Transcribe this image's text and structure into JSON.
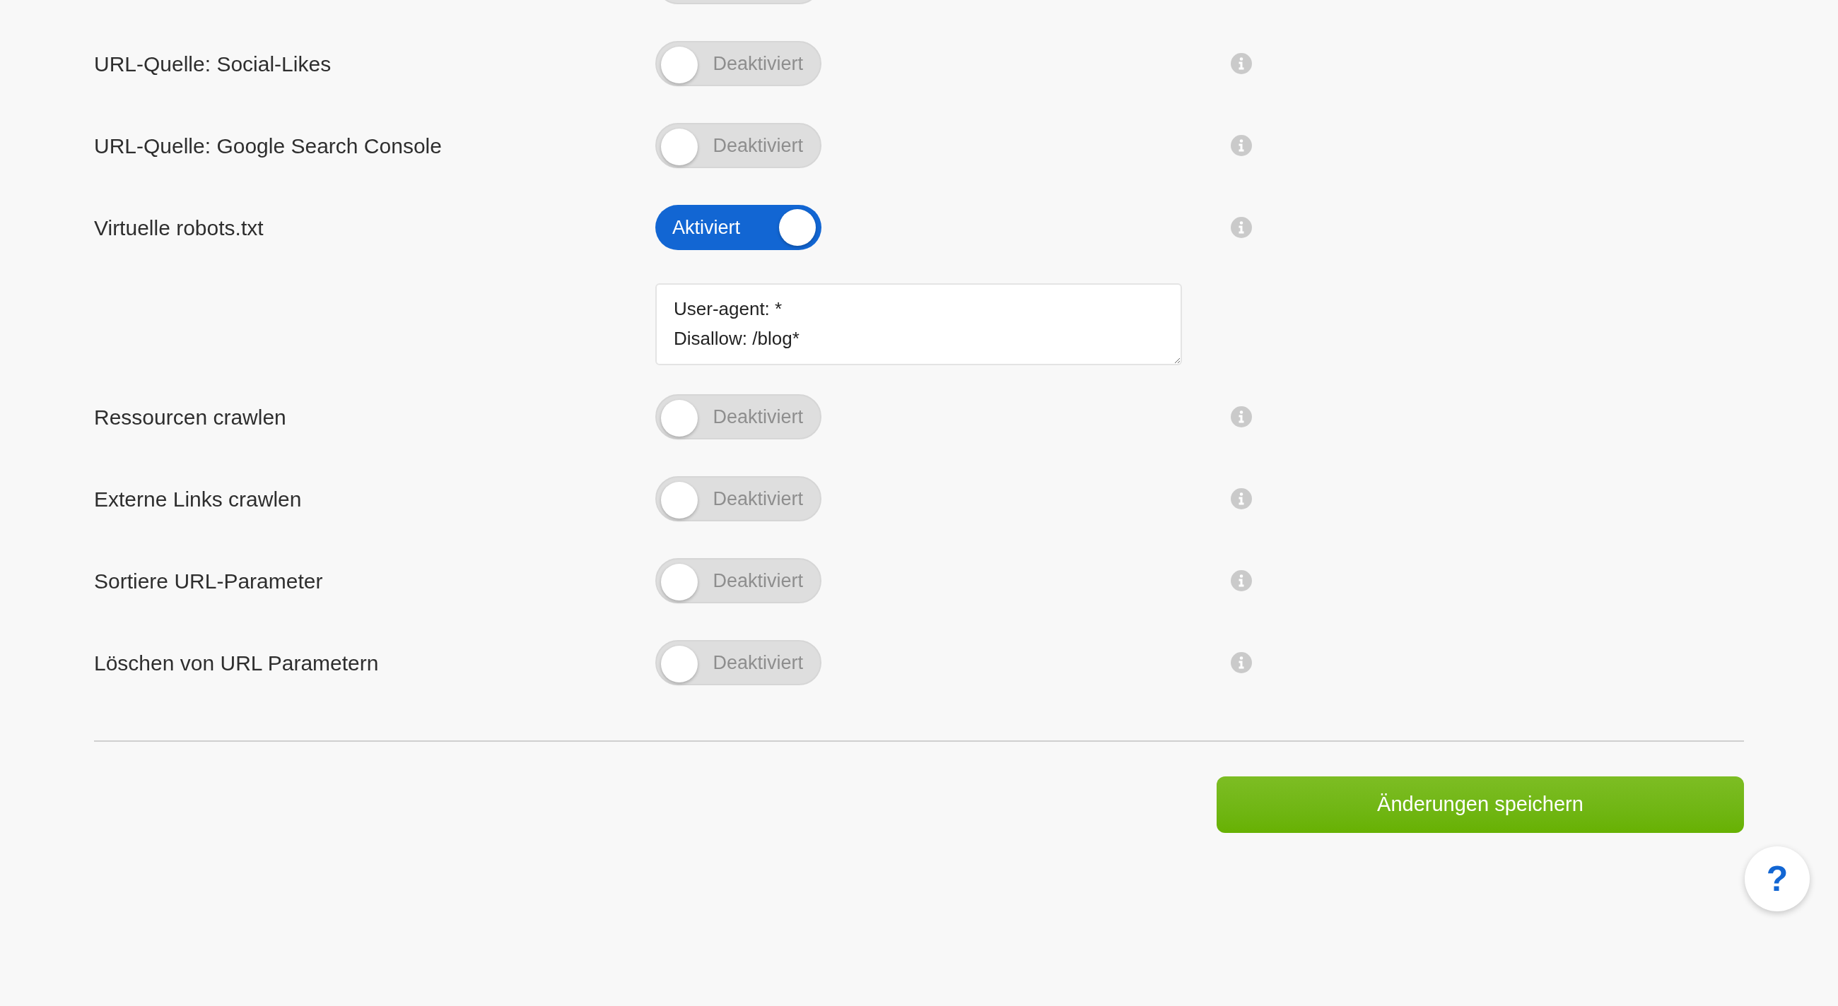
{
  "top_toggle": {
    "on": false
  },
  "settings": [
    {
      "label": "URL-Quelle: Social-Likes",
      "toggle": {
        "on": false,
        "text": "Deaktiviert"
      }
    },
    {
      "label": "URL-Quelle: Google Search Console",
      "toggle": {
        "on": false,
        "text": "Deaktiviert"
      }
    },
    {
      "label": "Virtuelle robots.txt",
      "toggle": {
        "on": true,
        "text": "Aktiviert"
      },
      "textarea": {
        "value": "User-agent: *\nDisallow: /blog*"
      }
    },
    {
      "label": "Ressourcen crawlen",
      "toggle": {
        "on": false,
        "text": "Deaktiviert"
      }
    },
    {
      "label": "Externe Links crawlen",
      "toggle": {
        "on": false,
        "text": "Deaktiviert"
      }
    },
    {
      "label": "Sortiere URL-Parameter",
      "toggle": {
        "on": false,
        "text": "Deaktiviert"
      }
    },
    {
      "label": "Löschen von URL Parametern",
      "toggle": {
        "on": false,
        "text": "Deaktiviert"
      }
    }
  ],
  "save_button": "Änderungen speichern",
  "help_button": "?"
}
